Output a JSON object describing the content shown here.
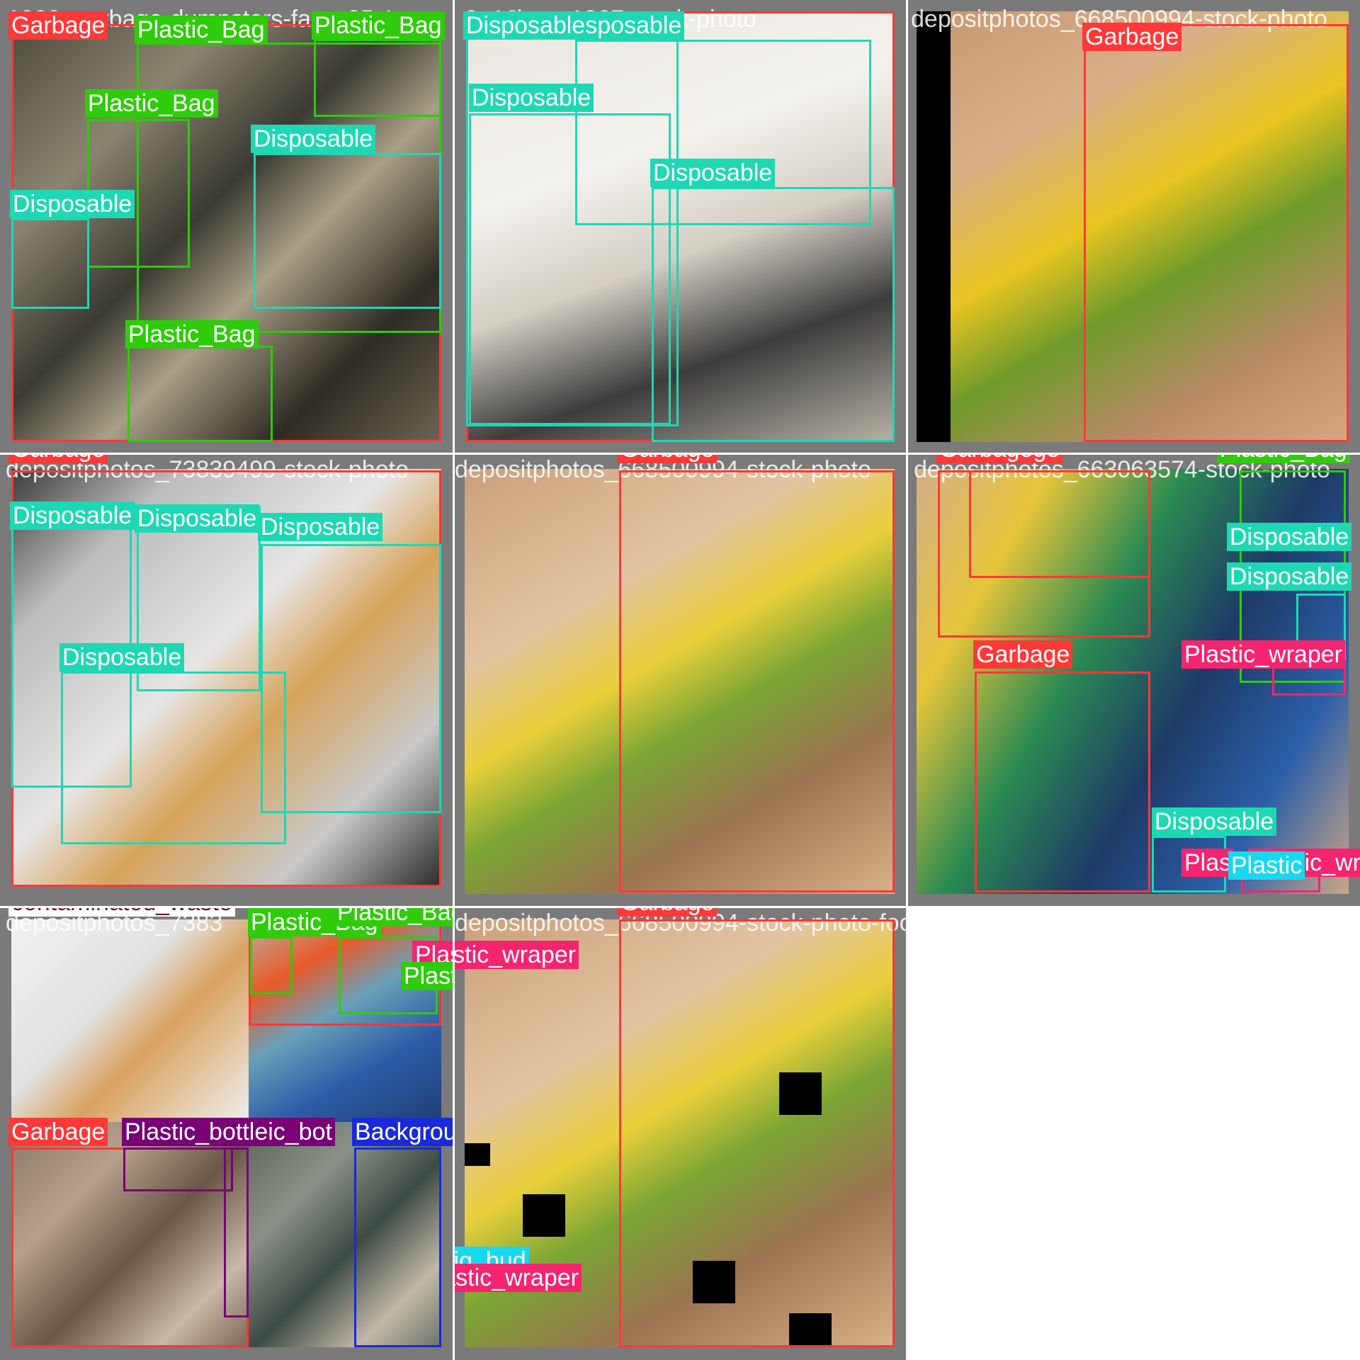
{
  "colors": {
    "garbage": "#ff3838",
    "plastic_bag": "#2ecc0a",
    "disposable": "#1ed8b4",
    "plastic_wraper": "#f5246e",
    "plastic_bottle": "#7a0077",
    "background": "#1a2ad8",
    "cig_bud": "#18d8ef",
    "contaminated_waste": "#6b1a1a"
  },
  "tiles": [
    {
      "name": "tile-1",
      "filename": "1000_garbage-dumpsters-farm-25-1"
    },
    {
      "name": "tile-2",
      "filename": "0_1Jh___1367-stock-photo"
    },
    {
      "name": "tile-3",
      "filename": "depositphotos_668500994-stock-photo"
    },
    {
      "name": "tile-4",
      "filename": "depositphotos_73839499-stock-photo"
    },
    {
      "name": "tile-5",
      "filename": "depositphotos_668500994-stock-photo"
    },
    {
      "name": "tile-6",
      "filename": "depositphotos_663063574-stock-photo"
    },
    {
      "name": "tile-7",
      "filename": "depositphotos_7383"
    },
    {
      "name": "tile-8",
      "filename": "depositphotos_668500994-stock-photo-food"
    }
  ],
  "labels": {
    "garbage": "Garbage",
    "garbagege": "Garbagege",
    "plastic_bag": "Plastic_Bag",
    "disposable": "Disposable",
    "disposable_sposable": "Disposablesposable",
    "plastic_wraper": "Plastic_wraper",
    "plastic_bottle": "Plastic_bottleic_bot",
    "background": "Background",
    "cig_bud": "Cig_bud",
    "contaminated_waste": "contaminated_waste",
    "plastic": "Plastic",
    "plas": "Plas"
  }
}
